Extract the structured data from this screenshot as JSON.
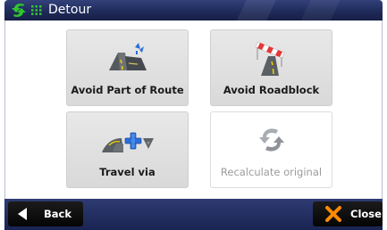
{
  "window": {
    "title": "Detour",
    "icons": [
      "back-arrow-icon",
      "grid-icon"
    ]
  },
  "options": [
    {
      "id": "avoid-part",
      "label": "Avoid Part of Route",
      "icon": "avoid-part-icon",
      "enabled": true
    },
    {
      "id": "avoid-roadblock",
      "label": "Avoid Roadblock",
      "icon": "roadblock-icon",
      "enabled": true
    },
    {
      "id": "travel-via",
      "label": "Travel via",
      "icon": "travel-via-icon",
      "enabled": true
    },
    {
      "id": "recalculate",
      "label": "Recalculate original",
      "icon": "recalculate-icon",
      "enabled": false
    }
  ],
  "bottom_bar": {
    "back_label": "Back",
    "close_label": "Close",
    "back_icon": "left-triangle-icon",
    "close_icon": "x-icon"
  },
  "colors": {
    "title_bar": "#1f2b5a",
    "bottom_bar": "#2a3769",
    "tile": "#e0e0e0",
    "close_x": "#ff8a00",
    "plus": "#2a6fd6"
  }
}
